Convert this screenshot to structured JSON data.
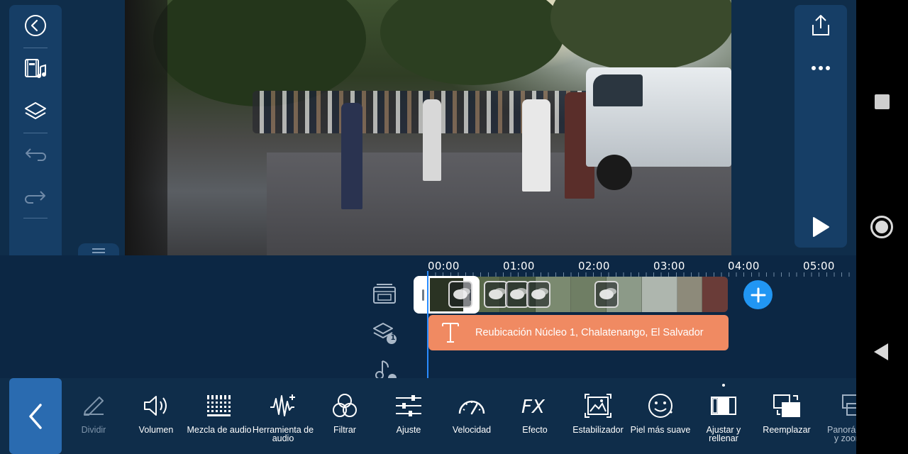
{
  "left_panel": {
    "items": [
      {
        "name": "back-circle-icon",
        "enabled": true
      },
      {
        "name": "media-music-icon",
        "enabled": true
      },
      {
        "name": "layers-icon",
        "enabled": true
      },
      {
        "name": "undo-icon",
        "enabled": false
      },
      {
        "name": "redo-icon",
        "enabled": false
      },
      {
        "name": "trash-icon",
        "enabled": true
      }
    ]
  },
  "right_panel": {
    "items": [
      "export-share-icon",
      "more-dots-icon",
      "play-icon"
    ]
  },
  "timeline": {
    "ruler": [
      "00:00",
      "01:00",
      "02:00",
      "03:00",
      "04:00",
      "05:00"
    ],
    "text_clip": "Reubicación Núcleo 1, Chalatenango, El Salvador",
    "layer_count_badge": "1"
  },
  "toolbar": {
    "back_icon": "chevron-left-icon",
    "tools": [
      {
        "label": "Dividir",
        "icon": "pencil-split-icon",
        "state": "disabled"
      },
      {
        "label": "Volumen",
        "icon": "volume-icon",
        "state": "normal"
      },
      {
        "label": "Mezcla de audio",
        "icon": "audio-mix-icon",
        "state": "normal"
      },
      {
        "label": "Herramienta de audio",
        "icon": "audio-tool-icon",
        "state": "normal"
      },
      {
        "label": "Filtrar",
        "icon": "filter-icon",
        "state": "normal"
      },
      {
        "label": "Ajuste",
        "icon": "sliders-icon",
        "state": "normal"
      },
      {
        "label": "Velocidad",
        "icon": "speedometer-icon",
        "state": "normal"
      },
      {
        "label": "Efecto",
        "icon": "fx-icon",
        "state": "normal"
      },
      {
        "label": "Estabilizador",
        "icon": "stabilizer-icon",
        "state": "normal"
      },
      {
        "label": "Piel más suave",
        "icon": "smile-icon",
        "state": "normal"
      },
      {
        "label": "Ajustar y rellenar",
        "icon": "fit-fill-icon",
        "state": "normal"
      },
      {
        "label": "Reemplazar",
        "icon": "replace-icon",
        "state": "normal"
      },
      {
        "label": "Panorámica y zoom",
        "icon": "pan-zoom-icon",
        "state": "cut"
      }
    ]
  },
  "colors": {
    "background": "#0f2d4a",
    "panel": "#163e66",
    "accent_blue": "#2196f3",
    "text_clip": "#f08a62",
    "back_button": "#2a6bb0"
  }
}
